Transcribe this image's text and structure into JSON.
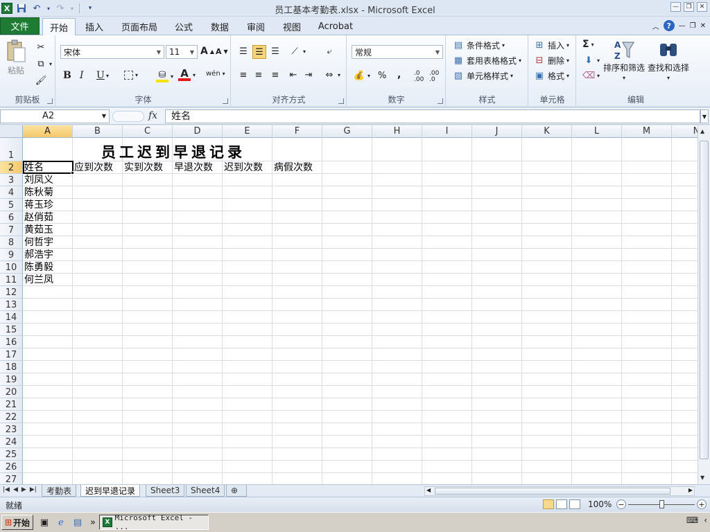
{
  "window": {
    "title": "员工基本考勤表.xlsx - Microsoft Excel"
  },
  "qat": {
    "logo": "X",
    "save_icon": "save-icon",
    "undo_icon": "undo-icon",
    "redo_icon": "redo-icon"
  },
  "ribbon_tabs": {
    "file": "文件",
    "items": [
      "开始",
      "插入",
      "页面布局",
      "公式",
      "数据",
      "审阅",
      "视图",
      "Acrobat"
    ],
    "active": "开始"
  },
  "ribbon": {
    "clipboard": {
      "paste": "粘贴",
      "label": "剪贴板"
    },
    "font": {
      "name": "宋体",
      "size": "11",
      "grow": "A",
      "shrink": "A",
      "bold": "B",
      "italic": "I",
      "underline": "U",
      "label": "字体",
      "phonetic": "wén"
    },
    "alignment": {
      "label": "对齐方式"
    },
    "number": {
      "format": "常规",
      "percent": "%",
      "comma": ",",
      "inc_decimal": ".0 .00",
      "dec_decimal": ".00 .0",
      "label": "数字"
    },
    "styles": {
      "conditional": "条件格式",
      "table": "套用表格格式",
      "cell_styles": "单元格样式",
      "label": "样式"
    },
    "cells": {
      "insert": "插入",
      "delete": "删除",
      "format": "格式",
      "label": "单元格"
    },
    "editing": {
      "sum": "Σ",
      "sort": "排序和筛选",
      "find": "查找和选择",
      "label": "编辑"
    }
  },
  "formula_bar": {
    "name_box": "A2",
    "fx": "fx",
    "content": "姓名"
  },
  "grid": {
    "columns": [
      "A",
      "B",
      "C",
      "D",
      "E",
      "F",
      "G",
      "H",
      "I",
      "J",
      "K",
      "L",
      "M",
      "N"
    ],
    "rows": [
      "1",
      "2",
      "3",
      "4",
      "5",
      "6",
      "7",
      "8",
      "9",
      "10",
      "11",
      "12",
      "13",
      "14",
      "15",
      "16",
      "17",
      "18",
      "19",
      "20",
      "21",
      "22",
      "23",
      "24",
      "25",
      "26",
      "27"
    ],
    "title": "员工迟到早退记录",
    "headers": [
      "姓名",
      "应到次数",
      "实到次数",
      "早退次数",
      "迟到次数",
      "病假次数"
    ],
    "names": [
      "刘凤义",
      "陈秋菊",
      "蒋玉珍",
      "赵俏茹",
      "黄茹玉",
      "何哲宇",
      "郝浩宇",
      "陈勇毅",
      "何兰凤"
    ]
  },
  "sheet_tabs": [
    "考勤表",
    "迟到早退记录",
    "Sheet3",
    "Sheet4"
  ],
  "active_sheet": "迟到早退记录",
  "status": {
    "text": "就绪",
    "zoom": "100%",
    "minus": "−",
    "plus": "+"
  },
  "taskbar": {
    "start": "开始",
    "task": "Microsoft Excel - ...",
    "more": "»"
  }
}
